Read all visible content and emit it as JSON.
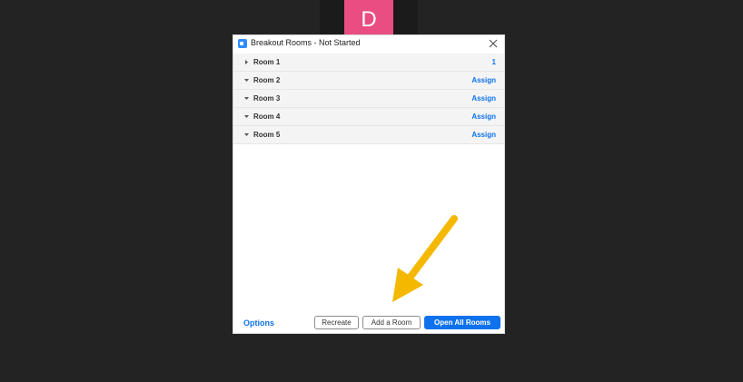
{
  "background_tile": {
    "avatar_letter": "D",
    "avatar_color": "#e94d82"
  },
  "dialog": {
    "title": "Breakout Rooms - Not Started",
    "rooms": [
      {
        "label": "Room 1",
        "action": "1",
        "expanded": false
      },
      {
        "label": "Room 2",
        "action": "Assign",
        "expanded": true
      },
      {
        "label": "Room 3",
        "action": "Assign",
        "expanded": true
      },
      {
        "label": "Room 4",
        "action": "Assign",
        "expanded": true
      },
      {
        "label": "Room 5",
        "action": "Assign",
        "expanded": true
      }
    ],
    "footer": {
      "options_label": "Options",
      "recreate_label": "Recreate",
      "add_room_label": "Add a Room",
      "open_all_label": "Open All Rooms"
    }
  },
  "colors": {
    "accent": "#0e72ed",
    "annotation_arrow": "#f5b800",
    "background": "#232323"
  },
  "icons": {
    "app": "zoom-app-icon",
    "close": "close-icon",
    "collapsed": "caret-right-icon",
    "expanded": "caret-down-icon",
    "annotation": "annotation-arrow-icon"
  }
}
